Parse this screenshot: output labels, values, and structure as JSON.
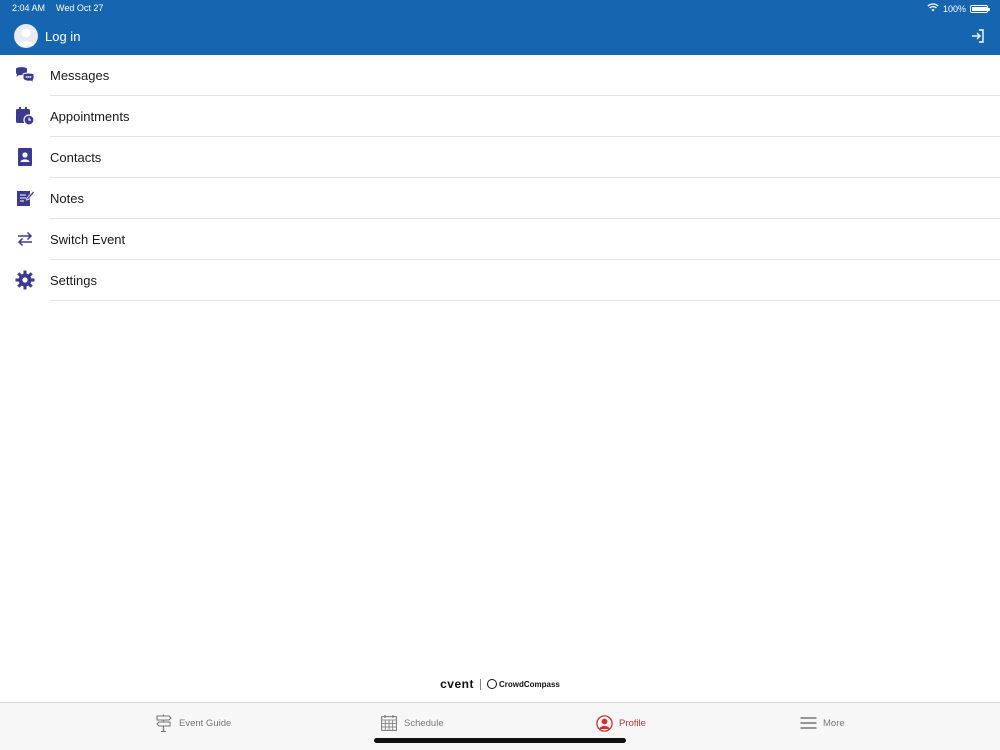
{
  "status_bar": {
    "time": "2:04 AM",
    "date": "Wed Oct 27",
    "battery_text": "100%",
    "battery_level": 1.0
  },
  "header": {
    "login_label": "Log in",
    "avatar_icon": "user-avatar-icon",
    "login_action_icon": "sign-in-icon",
    "background_color": "#1565b0"
  },
  "menu": {
    "icon_color": "#3b3a8f",
    "items": [
      {
        "label": "Messages",
        "icon": "chat-bubbles-icon"
      },
      {
        "label": "Appointments",
        "icon": "calendar-clock-icon"
      },
      {
        "label": "Contacts",
        "icon": "contact-book-icon"
      },
      {
        "label": "Notes",
        "icon": "note-pencil-icon"
      },
      {
        "label": "Switch Event",
        "icon": "swap-arrows-icon"
      },
      {
        "label": "Settings",
        "icon": "gear-icon"
      }
    ]
  },
  "brand": {
    "primary": "cvent",
    "secondary": "CrowdCompass"
  },
  "tabbar": {
    "active_color": "#d32f2f",
    "tabs": [
      {
        "label": "Event Guide",
        "icon": "signpost-icon",
        "active": false
      },
      {
        "label": "Schedule",
        "icon": "calendar-icon",
        "active": false
      },
      {
        "label": "Profile",
        "icon": "profile-icon",
        "active": true
      },
      {
        "label": "More",
        "icon": "hamburger-menu-icon",
        "active": false
      }
    ]
  }
}
